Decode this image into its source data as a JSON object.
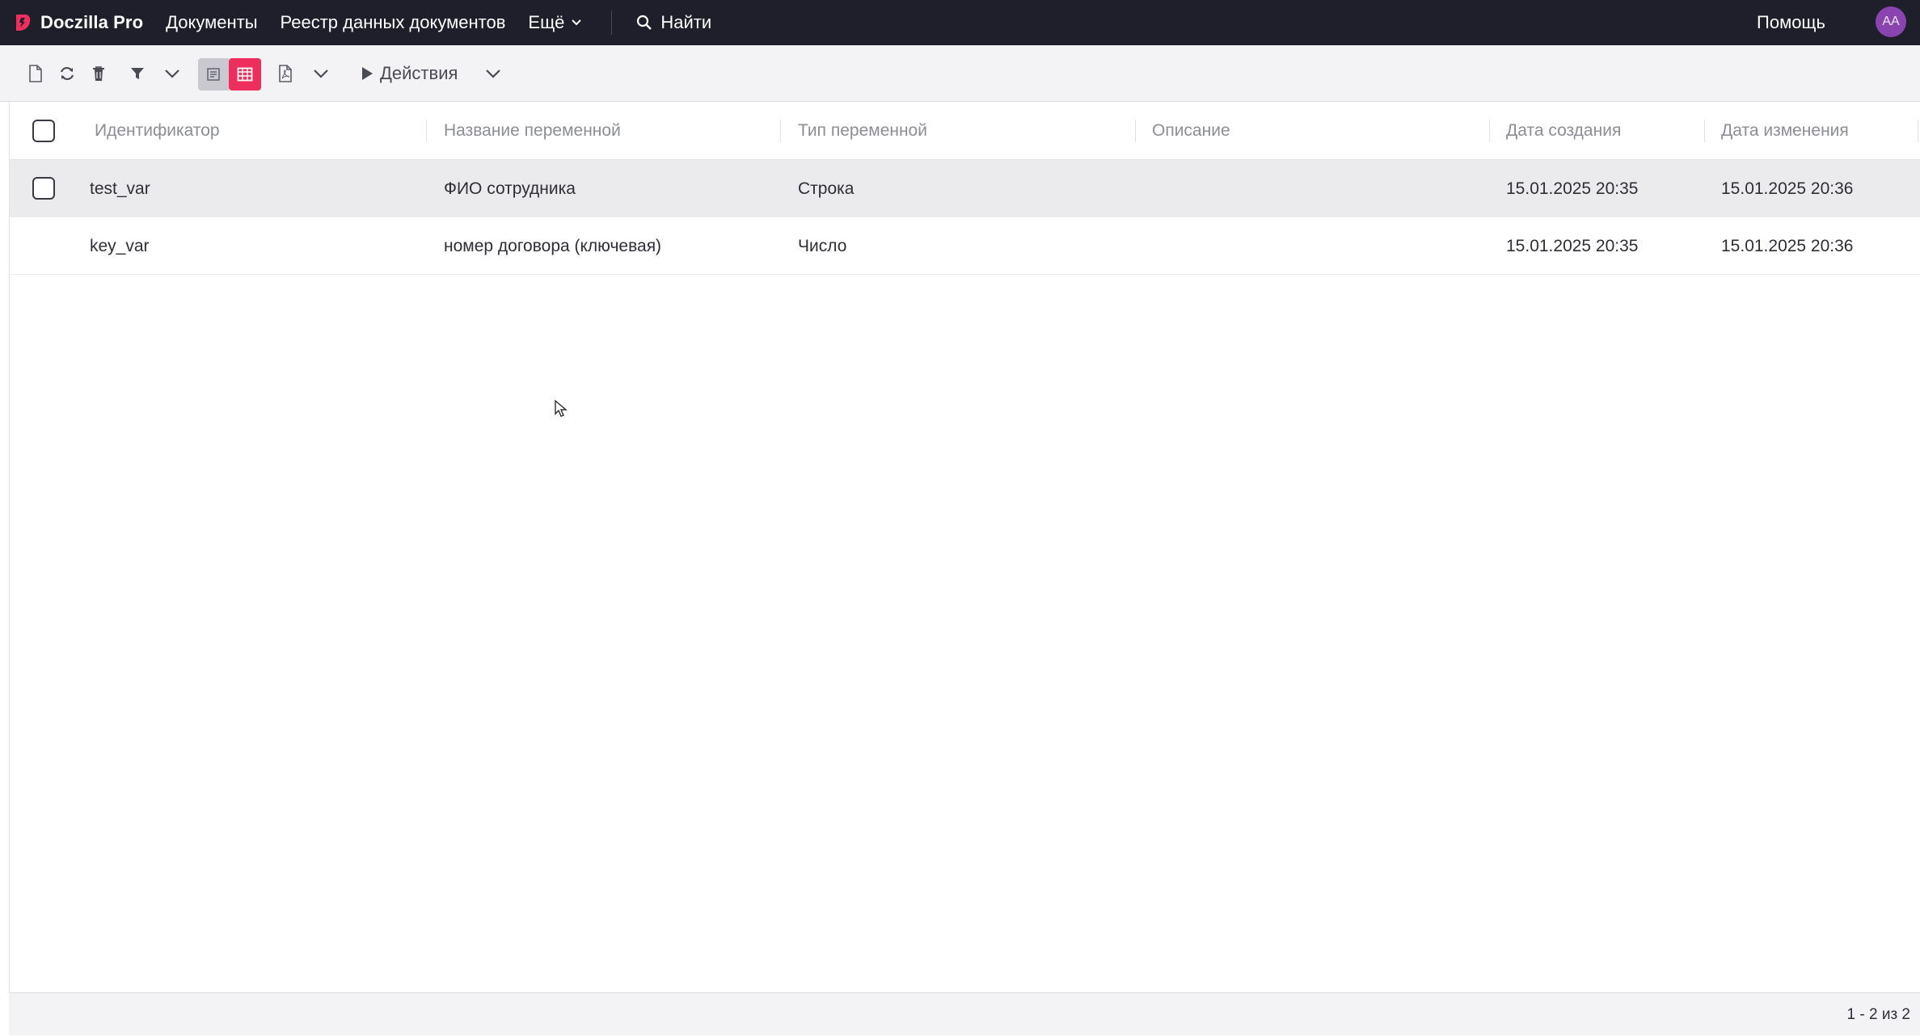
{
  "app": {
    "brand": "Doczilla Pro",
    "accent_color": "#ee2e5c",
    "topbar_color": "#1f1f2b",
    "avatar_color": "#8a44b0"
  },
  "nav": {
    "documents": "Документы",
    "registry": "Реестр данных документов",
    "more": "Ещё",
    "search": "Найти",
    "help": "Помощь",
    "avatar_initials": "AA"
  },
  "toolbar": {
    "actions_label": "Действия",
    "icons": [
      "new-document-icon",
      "refresh-icon",
      "trash-icon",
      "filter-icon",
      "chevron-down-icon",
      "form-view-icon",
      "table-view-icon",
      "pdf-icon",
      "chevron-down-icon",
      "play-icon",
      "chevron-down-icon"
    ]
  },
  "grid": {
    "columns": [
      "Идентификатор",
      "Название переменной",
      "Тип переменной",
      "Описание",
      "Дата создания",
      "Дата изменения"
    ],
    "rows": [
      {
        "id": "test_var",
        "name": "ФИО сотрудника",
        "type": "Строка",
        "description": "",
        "created": "15.01.2025 20:35",
        "modified": "15.01.2025 20:36",
        "selected": true
      },
      {
        "id": "key_var",
        "name": "номер договора (ключевая)",
        "type": "Число",
        "description": "",
        "created": "15.01.2025 20:35",
        "modified": "15.01.2025 20:36",
        "selected": false
      }
    ]
  },
  "footer": {
    "pager": "1 - 2 из 2"
  }
}
